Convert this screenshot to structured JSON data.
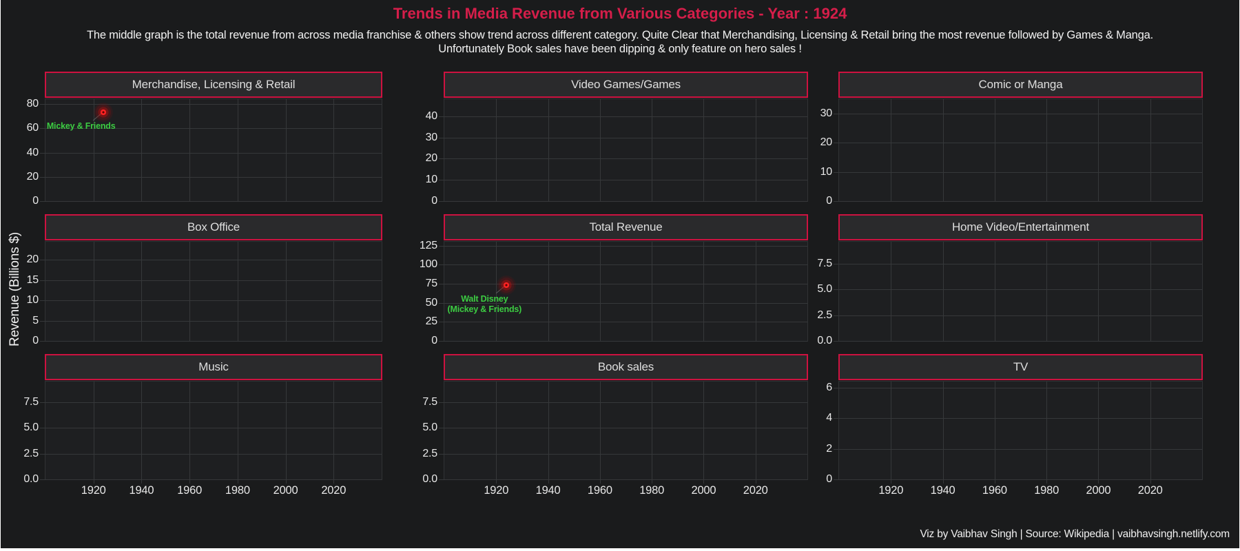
{
  "page": {
    "title": "Trends in Media Revenue from Various Categories - Year : 1924",
    "subtitle_line1": "The middle graph is the total revenue from across media franchise & others show trend across different category. Quite Clear that Merchandising, Licensing & Retail bring the most revenue followed by Games & Manga.",
    "subtitle_line2": "Unfortunately Book sales have been dipping & only feature on hero sales !",
    "ylabel": "Revenue (Billions $)",
    "footer": "Viz by Vaibhav Singh | Source: Wikipedia | vaibhavsingh.netlify.com",
    "year": "1924"
  },
  "colors": {
    "background": "#1a1b1c",
    "plot_background": "#1e1f21",
    "panel_background": "#2a2a2c",
    "accent_crimson": "#ce1240",
    "title_crimson": "#d51e4a",
    "grid": "#36383a",
    "text": "#e8e8e8",
    "annotation_green": "#3ccc42",
    "point_red": "#ff2222"
  },
  "x_axis": {
    "range": [
      1900,
      2040
    ],
    "ticks": [
      {
        "v": 1920,
        "label": "1920"
      },
      {
        "v": 1940,
        "label": "1940"
      },
      {
        "v": 1960,
        "label": "1960"
      },
      {
        "v": 1980,
        "label": "1980"
      },
      {
        "v": 2000,
        "label": "2000"
      },
      {
        "v": 2020,
        "label": "2020"
      }
    ]
  },
  "chart_data": [
    {
      "type": "scatter",
      "title": "Merchandise, Licensing & Retail",
      "ymax": 84,
      "yticks": [
        {
          "v": 80,
          "label": "80"
        },
        {
          "v": 60,
          "label": "60"
        },
        {
          "v": 40,
          "label": "40"
        },
        {
          "v": 20,
          "label": "20"
        },
        {
          "v": 0,
          "label": "0"
        }
      ],
      "show_x_labels": false,
      "points": [
        {
          "x": 1924,
          "y": 73,
          "label_lines": [
            "Mickey & Friends"
          ]
        }
      ]
    },
    {
      "type": "scatter",
      "title": "Video Games/Games",
      "ymax": 48,
      "yticks": [
        {
          "v": 40,
          "label": "40"
        },
        {
          "v": 30,
          "label": "30"
        },
        {
          "v": 20,
          "label": "20"
        },
        {
          "v": 10,
          "label": "10"
        },
        {
          "v": 0,
          "label": "0"
        }
      ],
      "show_x_labels": false,
      "points": []
    },
    {
      "type": "scatter",
      "title": "Comic or Manga",
      "ymax": 35,
      "yticks": [
        {
          "v": 30,
          "label": "30"
        },
        {
          "v": 20,
          "label": "20"
        },
        {
          "v": 10,
          "label": "10"
        },
        {
          "v": 0,
          "label": "0"
        }
      ],
      "show_x_labels": false,
      "points": []
    },
    {
      "type": "scatter",
      "title": "Box Office",
      "ymax": 24.5,
      "yticks": [
        {
          "v": 20,
          "label": "20"
        },
        {
          "v": 15,
          "label": "15"
        },
        {
          "v": 10,
          "label": "10"
        },
        {
          "v": 5,
          "label": "5"
        },
        {
          "v": 0,
          "label": "0"
        }
      ],
      "show_x_labels": false,
      "points": []
    },
    {
      "type": "scatter",
      "title": "Total Revenue",
      "ymax": 130,
      "yticks": [
        {
          "v": 125,
          "label": "125"
        },
        {
          "v": 100,
          "label": "100"
        },
        {
          "v": 75,
          "label": "75"
        },
        {
          "v": 50,
          "label": "50"
        },
        {
          "v": 25,
          "label": "25"
        },
        {
          "v": 0,
          "label": "0"
        }
      ],
      "show_x_labels": false,
      "points": [
        {
          "x": 1924,
          "y": 73,
          "label_lines": [
            "Walt Disney",
            "(Mickey & Friends)"
          ]
        }
      ]
    },
    {
      "type": "scatter",
      "title": "Home Video/Entertainment",
      "ymax": 9.6,
      "yticks": [
        {
          "v": 7.5,
          "label": "7.5"
        },
        {
          "v": 5,
          "label": "5.0"
        },
        {
          "v": 2.5,
          "label": "2.5"
        },
        {
          "v": 0,
          "label": "0.0"
        }
      ],
      "show_x_labels": false,
      "points": []
    },
    {
      "type": "scatter",
      "title": "Music",
      "ymax": 9.5,
      "yticks": [
        {
          "v": 7.5,
          "label": "7.5"
        },
        {
          "v": 5,
          "label": "5.0"
        },
        {
          "v": 2.5,
          "label": "2.5"
        },
        {
          "v": 0,
          "label": "0.0"
        }
      ],
      "show_x_labels": true,
      "points": []
    },
    {
      "type": "scatter",
      "title": "Book sales",
      "ymax": 9.5,
      "yticks": [
        {
          "v": 7.5,
          "label": "7.5"
        },
        {
          "v": 5,
          "label": "5.0"
        },
        {
          "v": 2.5,
          "label": "2.5"
        },
        {
          "v": 0,
          "label": "0.0"
        }
      ],
      "show_x_labels": true,
      "points": []
    },
    {
      "type": "scatter",
      "title": "TV",
      "ymax": 6.4,
      "yticks": [
        {
          "v": 6,
          "label": "6"
        },
        {
          "v": 4,
          "label": "4"
        },
        {
          "v": 2,
          "label": "2"
        },
        {
          "v": 0,
          "label": "0"
        }
      ],
      "show_x_labels": true,
      "points": []
    }
  ]
}
